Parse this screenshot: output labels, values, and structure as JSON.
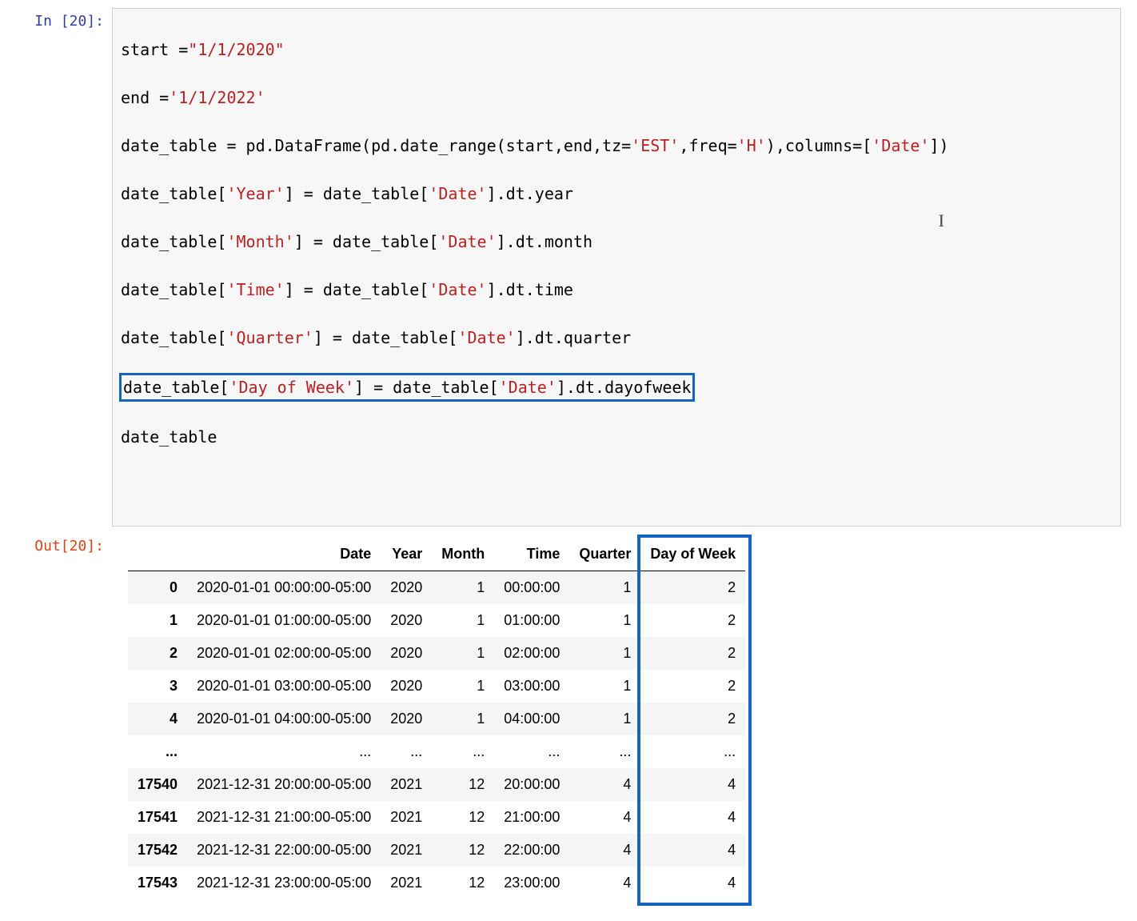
{
  "prompts": {
    "in": "In [20]:",
    "out": "Out[20]:"
  },
  "code": {
    "l1a": "start ",
    "l1b": "=",
    "l1c": "\"1/1/2020\"",
    "l2a": "end ",
    "l2b": "=",
    "l2c": "'1/1/2022'",
    "l3a": "date_table ",
    "l3b": "=",
    "l3c": " pd.DataFrame(pd.date_range(start,end,tz",
    "l3d": "=",
    "l3e": "'EST'",
    "l3f": ",freq",
    "l3g": "=",
    "l3h": "'H'",
    "l3i": "),columns",
    "l3j": "=",
    "l3k": "[",
    "l3l": "'Date'",
    "l3m": "])",
    "l4a": "date_table[",
    "l4b": "'Year'",
    "l4c": "] ",
    "l4d": "=",
    "l4e": " date_table[",
    "l4f": "'Date'",
    "l4g": "].dt.year",
    "l5a": "date_table[",
    "l5b": "'Month'",
    "l5c": "] ",
    "l5d": "=",
    "l5e": " date_table[",
    "l5f": "'Date'",
    "l5g": "].dt.month",
    "l6a": "date_table[",
    "l6b": "'Time'",
    "l6c": "] ",
    "l6d": "=",
    "l6e": " date_table[",
    "l6f": "'Date'",
    "l6g": "].dt.time",
    "l7a": "date_table[",
    "l7b": "'Quarter'",
    "l7c": "] ",
    "l7d": "=",
    "l7e": " date_table[",
    "l7f": "'Date'",
    "l7g": "].dt.quarter",
    "l8a": "date_table[",
    "l8b": "'Day of Week'",
    "l8c": "] ",
    "l8d": "=",
    "l8e": " date_table[",
    "l8f": "'Date'",
    "l8g": "].dt.dayofweek",
    "l9": "date_table"
  },
  "table": {
    "headers": [
      "",
      "Date",
      "Year",
      "Month",
      "Time",
      "Quarter",
      "Day of Week"
    ],
    "rows": [
      {
        "idx": "0",
        "Date": "2020-01-01 00:00:00-05:00",
        "Year": "2020",
        "Month": "1",
        "Time": "00:00:00",
        "Quarter": "1",
        "DayOfWeek": "2"
      },
      {
        "idx": "1",
        "Date": "2020-01-01 01:00:00-05:00",
        "Year": "2020",
        "Month": "1",
        "Time": "01:00:00",
        "Quarter": "1",
        "DayOfWeek": "2"
      },
      {
        "idx": "2",
        "Date": "2020-01-01 02:00:00-05:00",
        "Year": "2020",
        "Month": "1",
        "Time": "02:00:00",
        "Quarter": "1",
        "DayOfWeek": "2"
      },
      {
        "idx": "3",
        "Date": "2020-01-01 03:00:00-05:00",
        "Year": "2020",
        "Month": "1",
        "Time": "03:00:00",
        "Quarter": "1",
        "DayOfWeek": "2"
      },
      {
        "idx": "4",
        "Date": "2020-01-01 04:00:00-05:00",
        "Year": "2020",
        "Month": "1",
        "Time": "04:00:00",
        "Quarter": "1",
        "DayOfWeek": "2"
      },
      {
        "idx": "...",
        "Date": "...",
        "Year": "...",
        "Month": "...",
        "Time": "...",
        "Quarter": "...",
        "DayOfWeek": "..."
      },
      {
        "idx": "17540",
        "Date": "2021-12-31 20:00:00-05:00",
        "Year": "2021",
        "Month": "12",
        "Time": "20:00:00",
        "Quarter": "4",
        "DayOfWeek": "4"
      },
      {
        "idx": "17541",
        "Date": "2021-12-31 21:00:00-05:00",
        "Year": "2021",
        "Month": "12",
        "Time": "21:00:00",
        "Quarter": "4",
        "DayOfWeek": "4"
      },
      {
        "idx": "17542",
        "Date": "2021-12-31 22:00:00-05:00",
        "Year": "2021",
        "Month": "12",
        "Time": "22:00:00",
        "Quarter": "4",
        "DayOfWeek": "4"
      },
      {
        "idx": "17543",
        "Date": "2021-12-31 23:00:00-05:00",
        "Year": "2021",
        "Month": "12",
        "Time": "23:00:00",
        "Quarter": "4",
        "DayOfWeek": "4"
      }
    ]
  }
}
